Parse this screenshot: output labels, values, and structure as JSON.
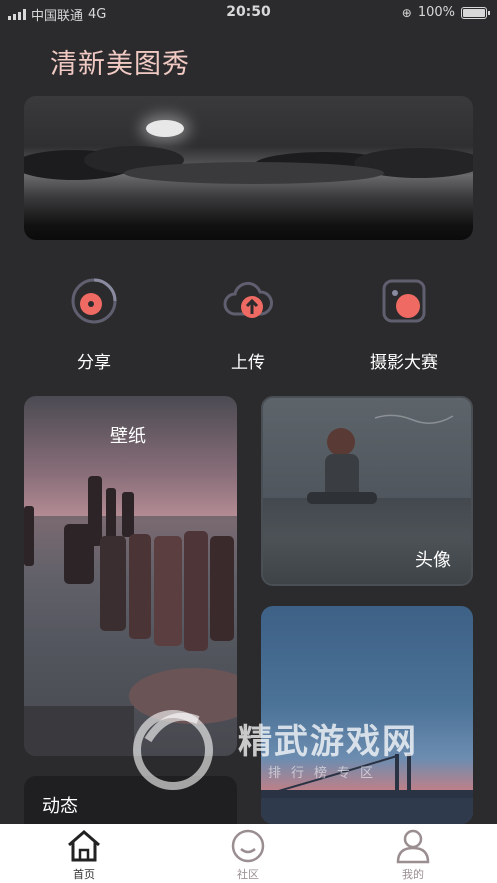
{
  "status_bar": {
    "carrier": "中国联通",
    "network": "4G",
    "time": "20:50",
    "battery_text": "100%",
    "battery_level": 1.0
  },
  "app_title": "清新美图秀",
  "quick_actions": [
    {
      "label": "分享",
      "icon": "share-disc-icon"
    },
    {
      "label": "上传",
      "icon": "upload-cloud-icon"
    },
    {
      "label": "摄影大赛",
      "icon": "photo-contest-icon"
    }
  ],
  "cards": {
    "wallpaper": "壁纸",
    "avatar": "头像",
    "dynamic": "动态"
  },
  "watermark": {
    "title": "精武游戏网",
    "subtitle": "排行榜专区"
  },
  "tab_bar": {
    "tabs": [
      {
        "label": "首页",
        "icon": "home-icon",
        "active": true
      },
      {
        "label": "社区",
        "icon": "smile-icon",
        "active": false
      },
      {
        "label": "我的",
        "icon": "user-icon",
        "active": false
      }
    ]
  },
  "colors": {
    "background": "#2b2b2d",
    "accent": "#ee6a62",
    "title": "#f0c9c3"
  }
}
